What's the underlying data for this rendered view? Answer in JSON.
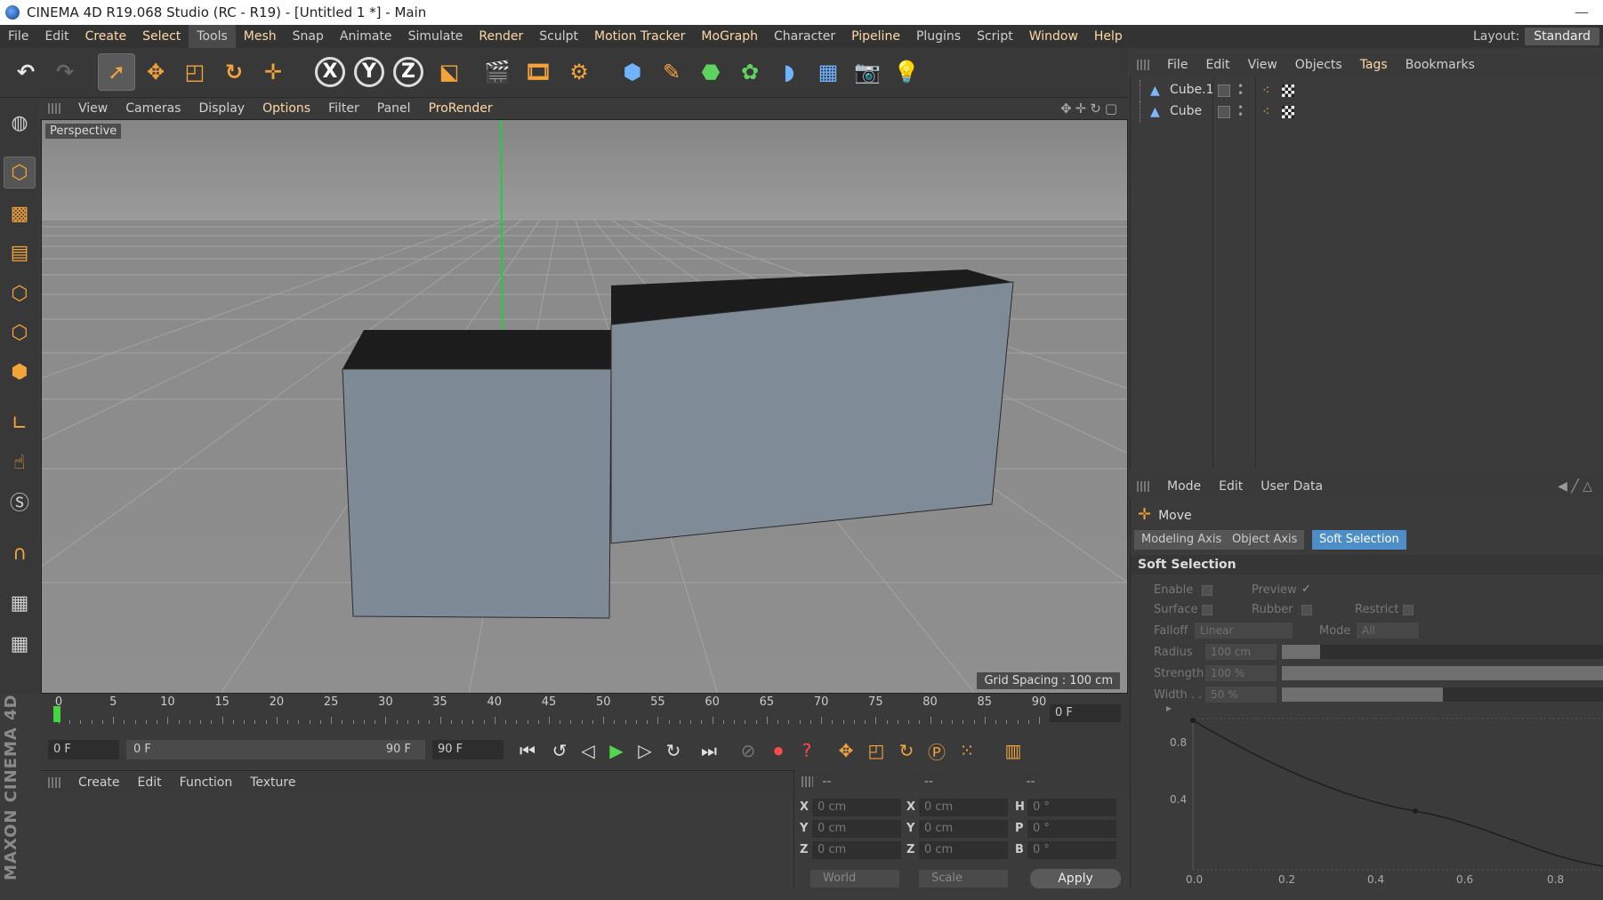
{
  "window": {
    "title": "CINEMA 4D R19.068 Studio (RC - R19) - [Untitled 1 *] - Main"
  },
  "menubar": {
    "items": [
      "File",
      "Edit",
      "Create",
      "Select",
      "Tools",
      "Mesh",
      "Snap",
      "Animate",
      "Simulate",
      "Render",
      "Sculpt",
      "Motion Tracker",
      "MoGraph",
      "Character",
      "Pipeline",
      "Plugins",
      "Script",
      "Window",
      "Help"
    ],
    "layout_label": "Layout:",
    "layout_value": "Standard"
  },
  "toolbar": {
    "x_axis": "X",
    "y_axis": "Y",
    "z_axis": "Z"
  },
  "viewport": {
    "menu": [
      "View",
      "Cameras",
      "Display",
      "Options",
      "Filter",
      "Panel",
      "ProRender"
    ],
    "camera_label": "Perspective",
    "grid_spacing": "Grid Spacing : 100 cm"
  },
  "timeline": {
    "ticks": [
      "0",
      "5",
      "10",
      "15",
      "20",
      "25",
      "30",
      "35",
      "40",
      "45",
      "50",
      "55",
      "60",
      "65",
      "70",
      "75",
      "80",
      "85",
      "90"
    ],
    "current_frame": "0 F"
  },
  "transport": {
    "start_frame": "0 F",
    "range_start": "0 F",
    "range_end": "90 F",
    "end_frame": "90 F"
  },
  "material_manager": {
    "menu": [
      "Create",
      "Edit",
      "Function",
      "Texture"
    ]
  },
  "logo": {
    "text": "MAXON CINEMA 4D"
  },
  "coordinates": {
    "head": [
      "--",
      "--",
      "--"
    ],
    "x": "X",
    "y": "Y",
    "z": "Z",
    "h": "H",
    "p": "P",
    "b": "B",
    "pos_x": "0 cm",
    "pos_y": "0 cm",
    "pos_z": "0 cm",
    "size_x": "0 cm",
    "size_y": "0 cm",
    "size_z": "0 cm",
    "rot_h": "0 °",
    "rot_p": "0 °",
    "rot_b": "0 °",
    "space": "World",
    "mode": "Scale",
    "apply": "Apply"
  },
  "object_manager": {
    "menu": [
      "File",
      "Edit",
      "View",
      "Objects",
      "Tags",
      "Bookmarks"
    ],
    "objects": [
      {
        "name": "Cube.1"
      },
      {
        "name": "Cube"
      }
    ]
  },
  "attribute_manager": {
    "menu": [
      "Mode",
      "Edit",
      "User Data"
    ],
    "tool": "Move",
    "tabs": [
      "Modeling Axis",
      "Object Axis",
      "Soft Selection"
    ],
    "section": "Soft Selection",
    "enable": "Enable",
    "preview": "Preview",
    "preview_check": "✓",
    "surface": "Surface",
    "rubber": "Rubber",
    "restrict": "Restrict",
    "falloff_label": "Falloff",
    "falloff_value": "Linear",
    "mode_label": "Mode",
    "mode_value": "All",
    "radius_label": "Radius",
    "radius_value": "100 cm",
    "radius_fill": 0.12,
    "strength_label": "Strength",
    "strength_value": "100 %",
    "strength_fill": 1.0,
    "width_label": "Width . .",
    "width_value": "50 %",
    "width_fill": 0.5,
    "graph_y_labels": [
      "0.8",
      "0.4",
      "0.0"
    ],
    "graph_x_labels": [
      "0.2",
      "0.4",
      "0.6",
      "0.8"
    ]
  },
  "colors": {
    "accent_orange": "#f2a33a",
    "selected_tab": "#4d8ec8",
    "timeline_marker": "#44d444",
    "menu_highlight": "#ffd9a8"
  }
}
